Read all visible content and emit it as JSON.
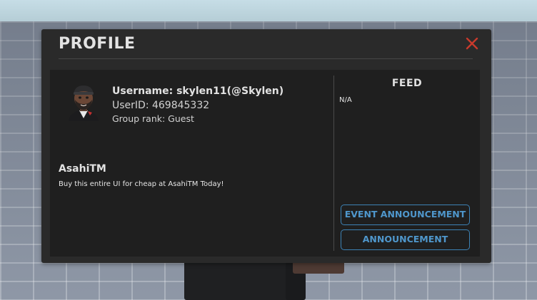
{
  "profile": {
    "title": "PROFILE",
    "username": "Username: skylen11(@Skylen)",
    "userid": "UserID: 469845332",
    "group_rank": "Group rank: Guest",
    "brand_name": "AsahiTM",
    "brand_tagline": "Buy this entire UI for cheap at AsahiTM Today!"
  },
  "feed": {
    "title": "FEED",
    "text": "N/A"
  },
  "buttons": {
    "event_announcement": "EVENT ANNOUNCEMENT",
    "announcement": "ANNOUNCEMENT"
  },
  "icons": {
    "close": "close-icon",
    "avatar": "avatar"
  },
  "colors": {
    "panel_bg": "#2a2a2a",
    "content_bg": "#1f1f1f",
    "accent_blue": "#3d82b5",
    "close_red": "#c83a2c"
  }
}
